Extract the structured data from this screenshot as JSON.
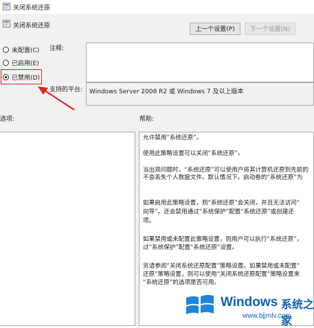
{
  "window": {
    "title": "关闭系统还原"
  },
  "header": {
    "policy_name": "关闭系统还原",
    "prev_button": "上一个设置(P)",
    "next_button": "下一个设置(N)"
  },
  "options": {
    "not_configured": "未配置(C)",
    "enabled": "已启用(E)",
    "disabled": "已禁用(D)",
    "selected": "disabled"
  },
  "labels": {
    "comment": "注释:",
    "supported_on": "支持的平台:",
    "options": "选项:",
    "help": "帮助:"
  },
  "supported_platforms": "Windows Server 2008 R2 或 Windows 7 及以上版本",
  "help_lines": [
    "允许禁用“系统还原”。",
    "使用此策略设置可以关闭“系统还原”。",
    "当出现问题时，“系统还原”可以使用户将其计算机还原到先前的",
    "不会丢失个人数据文件。默认情况下，启动卷的“系统还原”为",
    "如果启用此策略设置，则“系统还原”会关闭，并且无法访问“",
    "向导”。还会禁用通过“系统保护”配置“系统还原”或创建还",
    "项。",
    "如果禁用或未配置此策略设置，则用户可以执行“系统还原”，",
    "过“系统保护”配置“系统还原”设置。",
    "另请参阅“关闭系统还原配置”策略设置。如果禁用或未配置“",
    "还原”策略设置，则可以使用“关闭系统还原配置”策略设置来",
    "“系统还原”的选项是否可用。"
  ],
  "watermark": {
    "brand": "Windows",
    "cn": "系统之家",
    "url": "www.bjjmlv.com"
  },
  "colors": {
    "annotation_red": "#e02020",
    "watermark_blue": "#0b62b2"
  }
}
